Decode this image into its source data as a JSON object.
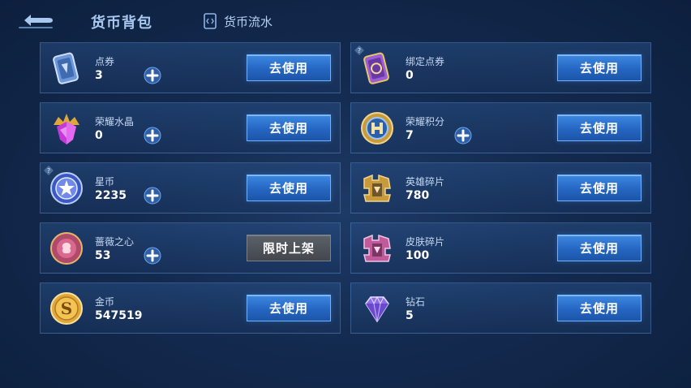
{
  "header": {
    "title": "货币背包",
    "flow_label": "货币流水"
  },
  "cards": [
    {
      "name": "点券",
      "value": "3",
      "action": "去使用",
      "icon": "ticket-card-icon",
      "has_plus": true,
      "has_help": false
    },
    {
      "name": "绑定点券",
      "value": "0",
      "action": "去使用",
      "icon": "bound-ticket-card-icon",
      "has_plus": false,
      "has_help": true
    },
    {
      "name": "荣耀水晶",
      "value": "0",
      "action": "去使用",
      "icon": "glory-crystal-icon",
      "has_plus": true,
      "has_help": false
    },
    {
      "name": "荣耀积分",
      "value": "7",
      "action": "去使用",
      "icon": "glory-points-icon",
      "has_plus": true,
      "has_help": false
    },
    {
      "name": "星币",
      "value": "2235",
      "action": "去使用",
      "icon": "star-coin-icon",
      "has_plus": true,
      "has_help": true
    },
    {
      "name": "英雄碎片",
      "value": "780",
      "action": "去使用",
      "icon": "hero-fragment-icon",
      "has_plus": false,
      "has_help": false
    },
    {
      "name": "蔷薇之心",
      "value": "53",
      "action": "限时上架",
      "icon": "rose-heart-icon",
      "has_plus": true,
      "has_help": false,
      "action_disabled": true
    },
    {
      "name": "皮肤碎片",
      "value": "100",
      "action": "去使用",
      "icon": "skin-fragment-icon",
      "has_plus": false,
      "has_help": false
    },
    {
      "name": "金币",
      "value": "547519",
      "action": "去使用",
      "icon": "gold-coin-icon",
      "has_plus": false,
      "has_help": false
    },
    {
      "name": "钻石",
      "value": "5",
      "action": "去使用",
      "icon": "diamond-icon",
      "has_plus": false,
      "has_help": false
    }
  ],
  "colors": {
    "background": "#132a4f",
    "button": "#2566c2",
    "button_disabled": "#4b5056",
    "accent": "#6fb0ff"
  }
}
